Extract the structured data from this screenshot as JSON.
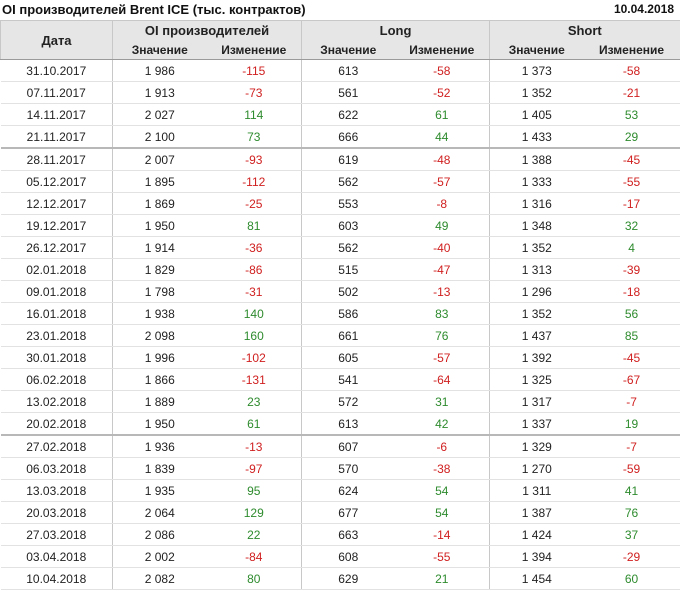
{
  "title": "OI производителей Brent ICE (тыс. контрактов)",
  "date": "10.04.2018",
  "headers": {
    "date": "Дата",
    "oi": "OI производителей",
    "long": "Long",
    "short": "Short",
    "value": "Значение",
    "change": "Изменение"
  },
  "colors": {
    "positive": "#2e8b2e",
    "negative": "#d02020"
  },
  "rows": [
    {
      "date": "31.10.2017",
      "oi": "1 986",
      "oi_chg": "-115",
      "long": "613",
      "long_chg": "-58",
      "short": "1 373",
      "short_chg": "-58"
    },
    {
      "date": "07.11.2017",
      "oi": "1 913",
      "oi_chg": "-73",
      "long": "561",
      "long_chg": "-52",
      "short": "1 352",
      "short_chg": "-21"
    },
    {
      "date": "14.11.2017",
      "oi": "2 027",
      "oi_chg": "114",
      "long": "622",
      "long_chg": "61",
      "short": "1 405",
      "short_chg": "53"
    },
    {
      "date": "21.11.2017",
      "oi": "2 100",
      "oi_chg": "73",
      "long": "666",
      "long_chg": "44",
      "short": "1 433",
      "short_chg": "29"
    },
    {
      "date": "28.11.2017",
      "oi": "2 007",
      "oi_chg": "-93",
      "long": "619",
      "long_chg": "-48",
      "short": "1 388",
      "short_chg": "-45",
      "group_start": true
    },
    {
      "date": "05.12.2017",
      "oi": "1 895",
      "oi_chg": "-112",
      "long": "562",
      "long_chg": "-57",
      "short": "1 333",
      "short_chg": "-55"
    },
    {
      "date": "12.12.2017",
      "oi": "1 869",
      "oi_chg": "-25",
      "long": "553",
      "long_chg": "-8",
      "short": "1 316",
      "short_chg": "-17"
    },
    {
      "date": "19.12.2017",
      "oi": "1 950",
      "oi_chg": "81",
      "long": "603",
      "long_chg": "49",
      "short": "1 348",
      "short_chg": "32"
    },
    {
      "date": "26.12.2017",
      "oi": "1 914",
      "oi_chg": "-36",
      "long": "562",
      "long_chg": "-40",
      "short": "1 352",
      "short_chg": "4"
    },
    {
      "date": "02.01.2018",
      "oi": "1 829",
      "oi_chg": "-86",
      "long": "515",
      "long_chg": "-47",
      "short": "1 313",
      "short_chg": "-39"
    },
    {
      "date": "09.01.2018",
      "oi": "1 798",
      "oi_chg": "-31",
      "long": "502",
      "long_chg": "-13",
      "short": "1 296",
      "short_chg": "-18"
    },
    {
      "date": "16.01.2018",
      "oi": "1 938",
      "oi_chg": "140",
      "long": "586",
      "long_chg": "83",
      "short": "1 352",
      "short_chg": "56"
    },
    {
      "date": "23.01.2018",
      "oi": "2 098",
      "oi_chg": "160",
      "long": "661",
      "long_chg": "76",
      "short": "1 437",
      "short_chg": "85"
    },
    {
      "date": "30.01.2018",
      "oi": "1 996",
      "oi_chg": "-102",
      "long": "605",
      "long_chg": "-57",
      "short": "1 392",
      "short_chg": "-45"
    },
    {
      "date": "06.02.2018",
      "oi": "1 866",
      "oi_chg": "-131",
      "long": "541",
      "long_chg": "-64",
      "short": "1 325",
      "short_chg": "-67"
    },
    {
      "date": "13.02.2018",
      "oi": "1 889",
      "oi_chg": "23",
      "long": "572",
      "long_chg": "31",
      "short": "1 317",
      "short_chg": "-7"
    },
    {
      "date": "20.02.2018",
      "oi": "1 950",
      "oi_chg": "61",
      "long": "613",
      "long_chg": "42",
      "short": "1 337",
      "short_chg": "19"
    },
    {
      "date": "27.02.2018",
      "oi": "1 936",
      "oi_chg": "-13",
      "long": "607",
      "long_chg": "-6",
      "short": "1 329",
      "short_chg": "-7",
      "group_start": true
    },
    {
      "date": "06.03.2018",
      "oi": "1 839",
      "oi_chg": "-97",
      "long": "570",
      "long_chg": "-38",
      "short": "1 270",
      "short_chg": "-59"
    },
    {
      "date": "13.03.2018",
      "oi": "1 935",
      "oi_chg": "95",
      "long": "624",
      "long_chg": "54",
      "short": "1 311",
      "short_chg": "41"
    },
    {
      "date": "20.03.2018",
      "oi": "2 064",
      "oi_chg": "129",
      "long": "677",
      "long_chg": "54",
      "short": "1 387",
      "short_chg": "76"
    },
    {
      "date": "27.03.2018",
      "oi": "2 086",
      "oi_chg": "22",
      "long": "663",
      "long_chg": "-14",
      "short": "1 424",
      "short_chg": "37"
    },
    {
      "date": "03.04.2018",
      "oi": "2 002",
      "oi_chg": "-84",
      "long": "608",
      "long_chg": "-55",
      "short": "1 394",
      "short_chg": "-29"
    },
    {
      "date": "10.04.2018",
      "oi": "2 082",
      "oi_chg": "80",
      "long": "629",
      "long_chg": "21",
      "short": "1 454",
      "short_chg": "60"
    }
  ]
}
